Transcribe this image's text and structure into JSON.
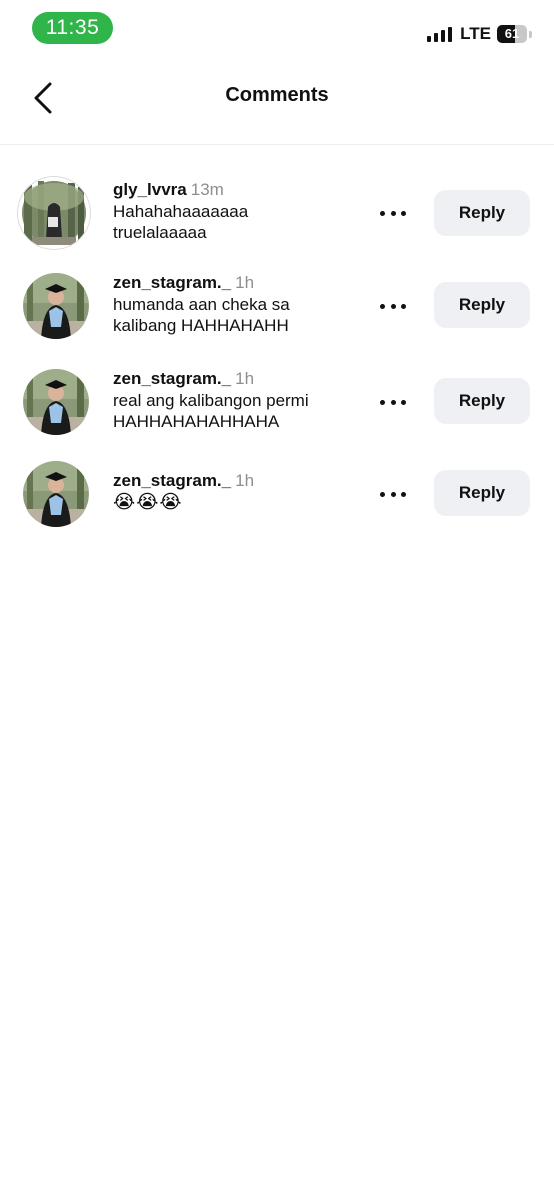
{
  "status_bar": {
    "time": "11:35",
    "network": "LTE",
    "battery": "61",
    "battery_level": 0.61
  },
  "header": {
    "title": "Comments",
    "back_icon": "chevron-left-icon"
  },
  "comments": [
    {
      "username": "gly_lvvra",
      "time": "13m",
      "text_lines": [
        "Hahahahaaaaaaa",
        "truelalaaaaa"
      ],
      "reply_label": "Reply",
      "more_icon": "more-horizontal-icon"
    },
    {
      "username": "zen_stagram._",
      "time": "1h",
      "text_lines": [
        "humanda aan cheka sa",
        "kalibang HAHHAHAHH"
      ],
      "reply_label": "Reply",
      "more_icon": "more-horizontal-icon"
    },
    {
      "username": "zen_stagram._",
      "time": "1h",
      "text_lines": [
        "real ang kalibangon permi",
        "HAHHAHAHAHHAHA"
      ],
      "reply_label": "Reply",
      "more_icon": "more-horizontal-icon"
    },
    {
      "username": "zen_stagram._",
      "time": "1h",
      "text_lines": [
        "😭😭😭"
      ],
      "reply_label": "Reply",
      "more_icon": "more-horizontal-icon"
    }
  ]
}
